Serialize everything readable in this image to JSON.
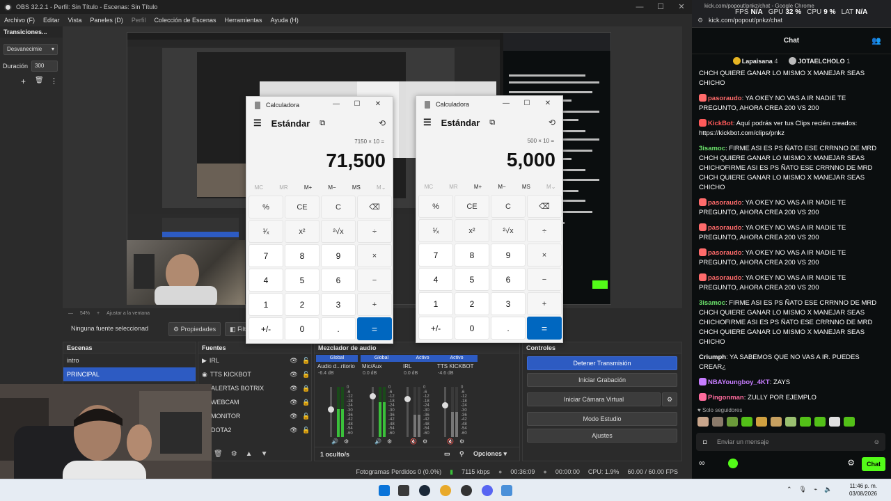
{
  "obs": {
    "title": "OBS 32.2.1 - Perfil: Sin Título - Escenas: Sin Título",
    "menu": [
      "Archivo (F)",
      "Editar",
      "Vista",
      "Paneles (D)",
      "Perfil",
      "Colección de Escenas",
      "Herramientas",
      "Ayuda (H)"
    ],
    "transitions": {
      "title": "Transiciones...",
      "type": "Desvanecimie",
      "duration_label": "Duración",
      "duration_value": "300"
    },
    "zoom": "54%",
    "fit_label": "Ajustar a la ventana",
    "source_bar": {
      "no_source": "Ninguna fuente seleccionad",
      "properties": "Propiedades",
      "filters": "Filtr"
    },
    "scenes": {
      "title": "Escenas",
      "items": [
        "intro",
        "PRINCIPAL"
      ],
      "selected": "PRINCIPAL"
    },
    "sources": {
      "title": "Fuentes",
      "items": [
        "IRL",
        "TTS KICKBOT",
        "ALERTAS BOTRIX",
        "WEBCAM",
        "MONITOR",
        "DOTA2"
      ]
    },
    "mixer": {
      "title": "Mezclador de audio",
      "hidden_label": "1 oculto/s",
      "options_label": "Opciones",
      "channels": [
        {
          "hdr": "Global",
          "name": "Audio d...ritorio",
          "db": "-6.4 dB",
          "level": 0.55,
          "fader": 0.45
        },
        {
          "hdr": "Global",
          "name": "Mic/Aux",
          "db": "0.0 dB",
          "level": 0.7,
          "fader": 0.15
        },
        {
          "hdr": "Activo",
          "name": "IRL",
          "db": "0.0 dB",
          "level": 0.45,
          "fader": 0.2
        },
        {
          "hdr": "Activo",
          "name": "TTS KICKBOT",
          "db": "-4.6 dB",
          "level": 0.5,
          "fader": 0.35
        }
      ],
      "ticks": [
        "0",
        "-6",
        "-12",
        "-18",
        "-24",
        "-30",
        "-36",
        "-42",
        "-48",
        "-54",
        "-60"
      ]
    },
    "controls": {
      "title": "Controles",
      "buttons": [
        "Detener Transmisión",
        "Iniciar Grabación",
        "Iniciar Cámara Virtual",
        "Modo Estudio",
        "Ajustes"
      ]
    },
    "status": {
      "dropped": "Fotogramas Perdidos 0 (0.0%)",
      "bitrate": "7115 kbps",
      "live_time": "00:36:09",
      "rec_time": "00:00:00",
      "cpu": "CPU: 1.9%",
      "fps": "60.00 / 60.00 FPS"
    }
  },
  "calculators": [
    {
      "title": "Calculadora",
      "mode": "Estándar",
      "expr": "7150 × 10 =",
      "result": "71,500"
    },
    {
      "title": "Calculadora",
      "mode": "Estándar",
      "expr": "500 × 10 =",
      "result": "5,000"
    }
  ],
  "calc_keys": [
    "%",
    "CE",
    "C",
    "⌫",
    "¹⁄ₓ",
    "x²",
    "²√x",
    "÷",
    "7",
    "8",
    "9",
    "×",
    "4",
    "5",
    "6",
    "−",
    "1",
    "2",
    "3",
    "+",
    "+/-",
    "0",
    ".",
    "="
  ],
  "calc_mem": [
    "MC",
    "MR",
    "M+",
    "M−",
    "MS",
    "M⌄"
  ],
  "chat": {
    "tab_title": "kick.com/popout/pnkz/chat - Google Chrome",
    "url": "kick.com/popout/pnkz/chat",
    "stats": [
      {
        "label": "FPS",
        "value": "N/A"
      },
      {
        "label": "GPU",
        "value": "32 %"
      },
      {
        "label": "CPU",
        "value": "9 %"
      },
      {
        "label": "LAT",
        "value": "N/A"
      }
    ],
    "header": "Chat",
    "leaders": [
      {
        "rank": "1",
        "name": "Lapaisana",
        "count": "4"
      },
      {
        "rank": "2",
        "name": "JOTAELCHOLO",
        "count": "1"
      }
    ],
    "messages": [
      {
        "user": "",
        "color": "#ffffff",
        "text": "CHCH QUIERE GANAR LO MISMO X MANEJAR SEAS CHICHO"
      },
      {
        "user": "pasoraudo",
        "color": "#ff6b6b",
        "text": ": YA OKEY NO VAS A IR NADIE TE PREGUNTO, AHORA CREA 200 VS 200"
      },
      {
        "user": "KickBot",
        "color": "#ff5a5a",
        "text": ": Aquí podrás ver tus Clips recién creados: https://kickbot.com/clips/pnkz"
      },
      {
        "user": "3isamoc",
        "color": "#6be36b",
        "text": ": FIRME ASI ES PS ÑATO ESE CRRNNO DE MRD CHCH QUIERE GANAR LO MISMO X MANEJAR SEAS CHICHOFIRME ASI ES PS ÑATO ESE CRRNNO DE MRD CHCH QUIERE GANAR LO MISMO X MANEJAR SEAS CHICHO"
      },
      {
        "user": "pasoraudo",
        "color": "#ff6b6b",
        "text": ": YA OKEY NO VAS A IR NADIE TE PREGUNTO, AHORA CREA 200 VS 200"
      },
      {
        "user": "pasoraudo",
        "color": "#ff6b6b",
        "text": ": YA OKEY NO VAS A IR NADIE TE PREGUNTO, AHORA CREA 200 VS 200"
      },
      {
        "user": "pasoraudo",
        "color": "#ff6b6b",
        "text": ": YA OKEY NO VAS A IR NADIE TE PREGUNTO, AHORA CREA 200 VS 200"
      },
      {
        "user": "pasoraudo",
        "color": "#ff6b6b",
        "text": ": YA OKEY NO VAS A IR NADIE TE PREGUNTO, AHORA CREA 200 VS 200"
      },
      {
        "user": "3isamoc",
        "color": "#6be36b",
        "text": ": FIRME ASI ES PS ÑATO ESE CRRNNO DE MRD CHCH QUIERE GANAR LO MISMO X MANEJAR SEAS CHICHOFIRME ASI ES PS ÑATO ESE CRRNNO DE MRD CHCH QUIERE GANAR LO MISMO X MANEJAR SEAS CHICHO"
      },
      {
        "user": "Criumph",
        "color": "#ffffff",
        "text": ": YA SABEMOS QUE NO VAS A IR. PUEDES CREAR¿"
      },
      {
        "user": "NBAYoungboy_4KT",
        "color": "#c77dff",
        "text": ": ZAYS"
      },
      {
        "user": "Pingonman",
        "color": "#ff6b9d",
        "text": ": ZULLY POR EJEMPLO"
      }
    ],
    "followers_label": "Solo seguidores",
    "input_placeholder": "Enviar un mensaje",
    "send_label": "Chat"
  },
  "taskbar": {
    "time": "11:46 p. m.",
    "date": "03/08/2026"
  }
}
